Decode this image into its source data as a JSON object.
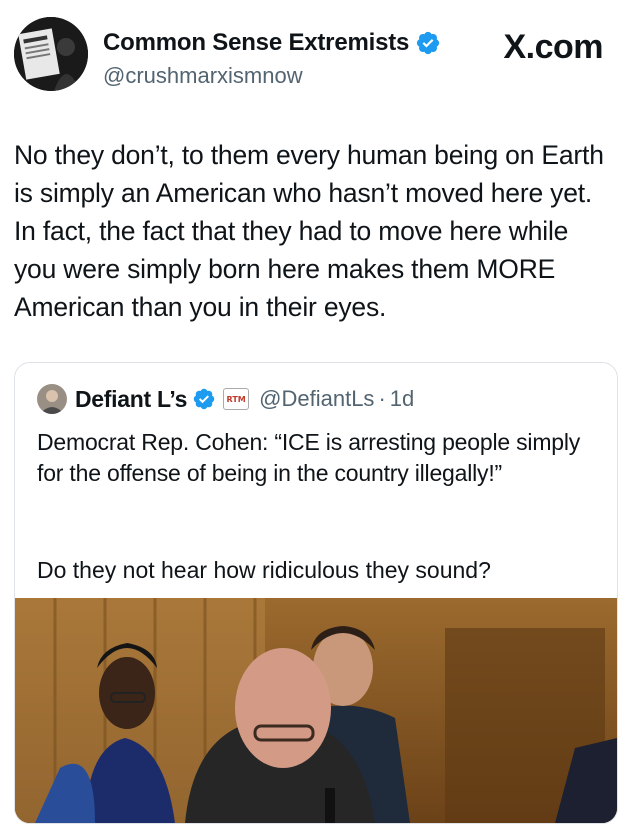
{
  "post": {
    "author_name": "Common Sense Extremists",
    "author_handle": "@crushmarxismnow",
    "brand": "X.com",
    "text": "No they don’t, to them every human being on Earth is simply an American who hasn’t moved here yet. In fact, the fact that they had to move here while you were simply born here makes them MORE American than you in their eyes.",
    "avatar_icon": "newspaper-avatar",
    "verified_icon": "verified-badge-icon"
  },
  "quote": {
    "author_name": "Defiant L’s",
    "badge": "RTM",
    "author_handle": "@DefiantLs",
    "separator": "·",
    "time": "1d",
    "text": "Democrat Rep. Cohen: “ICE is arresting people simply for the offense of being in the country illegally!”",
    "text2": "Do they not hear how ridiculous they sound?",
    "media_icon": "video-still-image"
  },
  "colors": {
    "verified": "#1d9bf0",
    "secondary_text": "#536471",
    "text": "#0f1419"
  }
}
